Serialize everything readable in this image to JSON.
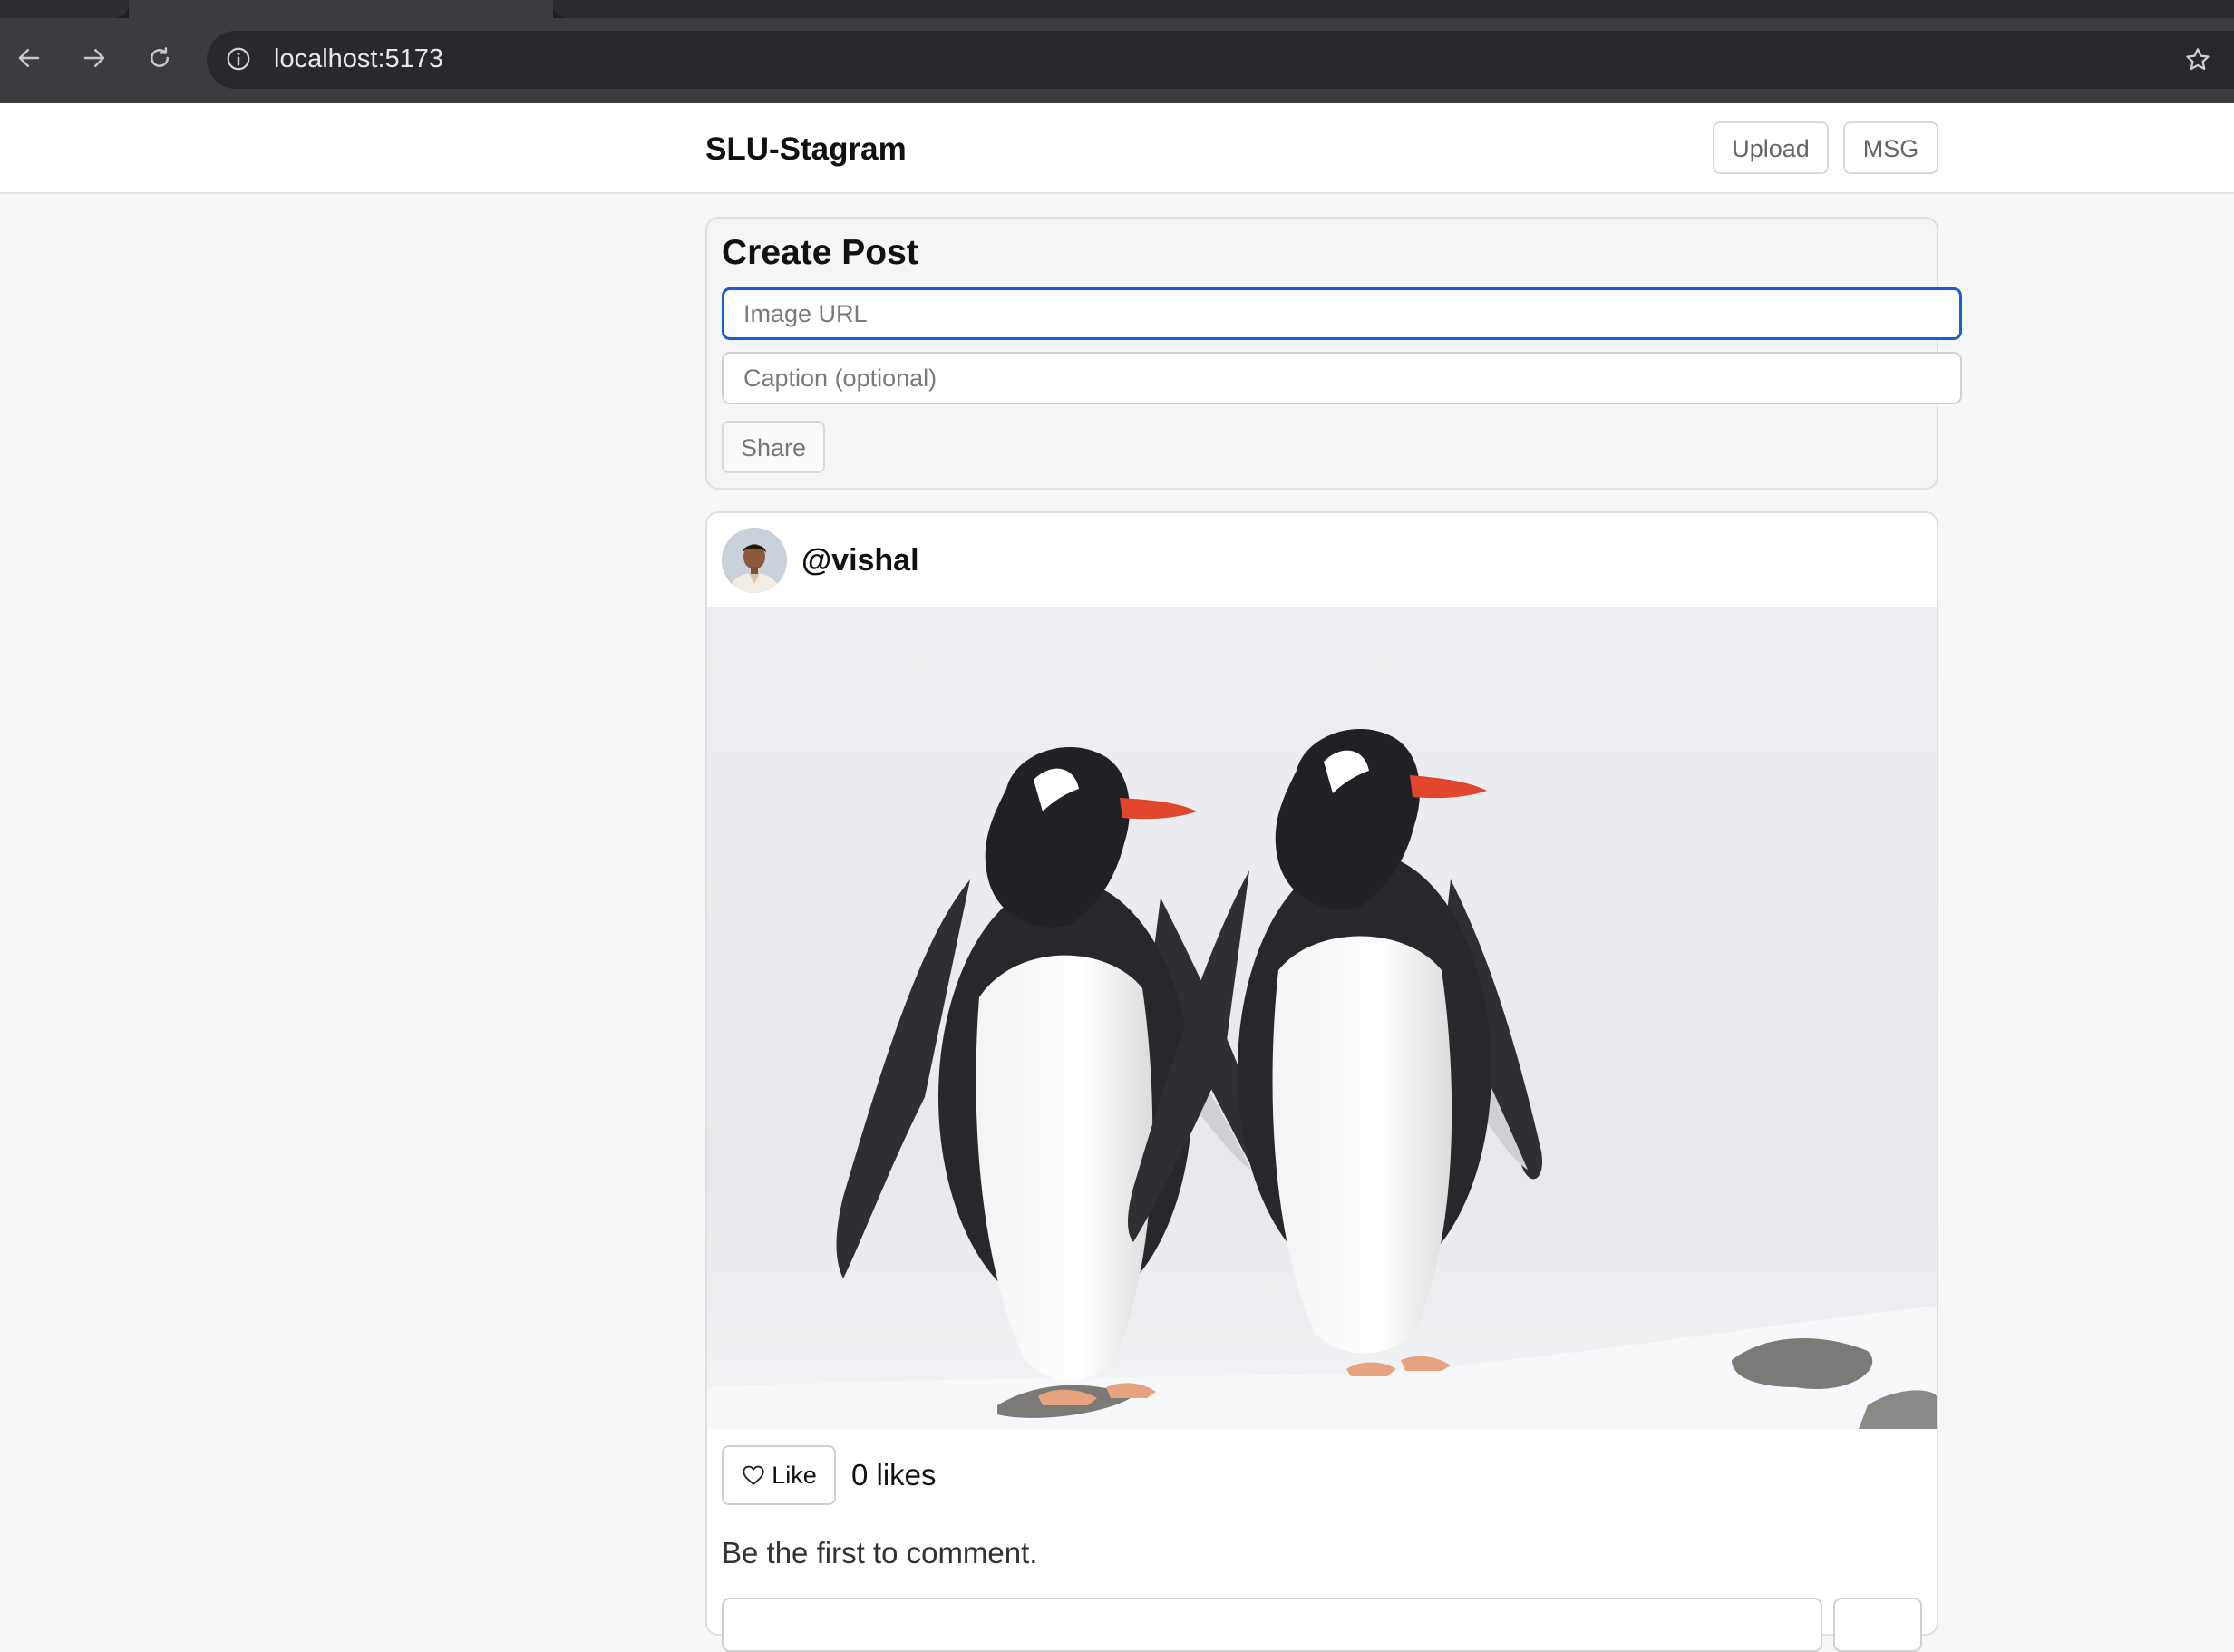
{
  "browser": {
    "url": "localhost:5173",
    "icons": {
      "back": "arrow-left-icon",
      "forward": "arrow-right-icon",
      "reload": "reload-icon",
      "site_info": "info-icon",
      "bookmark": "star-icon"
    }
  },
  "header": {
    "brand": "SLU-Stagram",
    "upload_label": "Upload",
    "msg_label": "MSG"
  },
  "create_post": {
    "title": "Create Post",
    "image_url_placeholder": "Image URL",
    "caption_placeholder": "Caption (optional)",
    "share_label": "Share"
  },
  "post": {
    "username": "@vishal",
    "like_label": "Like",
    "likes_text": "0 likes",
    "comments_empty": "Be the first to comment."
  },
  "colors": {
    "focus_ring": "#1a5dd1",
    "page_bg": "#f7f7f7",
    "beak": "#e2462c"
  }
}
